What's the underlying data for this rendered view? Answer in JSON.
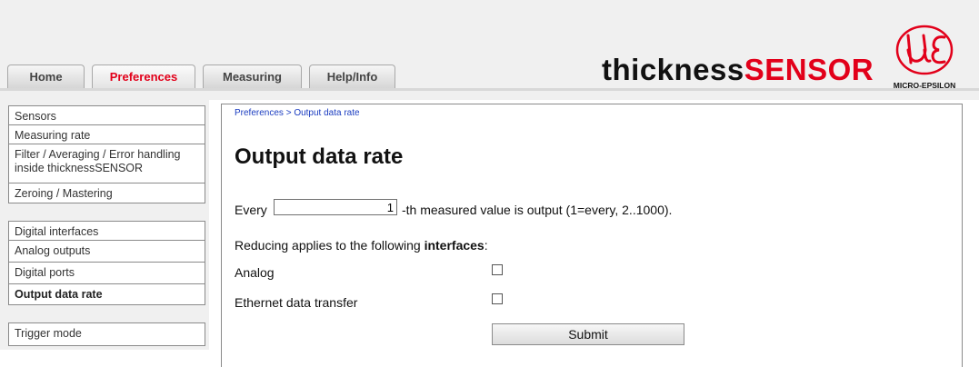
{
  "tabs": [
    {
      "label": "Home"
    },
    {
      "label": "Preferences"
    },
    {
      "label": "Measuring"
    },
    {
      "label": "Help/Info"
    }
  ],
  "brand": {
    "part1": "thickness",
    "part2": "SENSOR",
    "logo_text": "MICRO-EPSILON",
    "accent": "#e2001a"
  },
  "sidebar": {
    "items": [
      {
        "label": "Sensors"
      },
      {
        "label": "Measuring rate"
      },
      {
        "label": "Filter / Averaging / Error handling inside thicknessSENSOR"
      },
      {
        "label": "Zeroing / Mastering"
      },
      {
        "label": "Digital interfaces"
      },
      {
        "label": "Analog outputs"
      },
      {
        "label": "Digital ports"
      },
      {
        "label": "Output data rate"
      },
      {
        "label": "Trigger mode"
      }
    ]
  },
  "main": {
    "breadcrumb": "Preferences > Output data rate",
    "title": "Output data rate",
    "every_label": "Every",
    "every_value": "1",
    "every_suffix": "-th measured value is output (1=every, 2..1000).",
    "reduce_text_prefix": "Reducing applies to the following ",
    "reduce_text_bold": "interfaces",
    "reduce_text_suffix": ":",
    "analog_label": "Analog",
    "ethernet_label": "Ethernet data transfer",
    "submit_label": "Submit"
  }
}
